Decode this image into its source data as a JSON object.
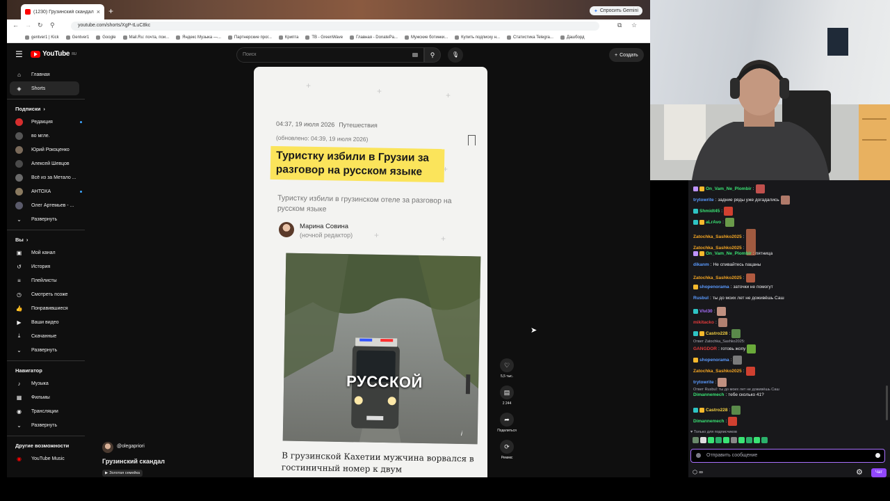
{
  "browser": {
    "tab_title": "(1230) Грузинский скандал",
    "new_tab": "+",
    "gemini_button": "Спросить Gemini",
    "url": "youtube.com/shorts/XgP-tLuC8kc",
    "bookmarks": [
      "gentver1 | Kick",
      "Gentver1",
      "Google",
      "Mail.Ru: почта, пои...",
      "Яндекс Музыка —...",
      "Партнерские прог...",
      "Крипта",
      "TB - GreenWave",
      "Главная - DonatePa...",
      "Мужские ботинки...",
      "Купить подписку н...",
      "Статистика Telegra...",
      "Дашборд"
    ]
  },
  "youtube": {
    "logo": "YouTube",
    "region": "RU",
    "search_placeholder": "Поиск",
    "create_label": "Создать",
    "sidebar": {
      "main": [
        {
          "label": "Главная",
          "icon": "home-icon"
        },
        {
          "label": "Shorts",
          "icon": "shorts-icon"
        }
      ],
      "subscriptions_title": "Подписки",
      "subscriptions": [
        {
          "label": "Редакция",
          "color": "#d62e2e",
          "live": true
        },
        {
          "label": "во мгле.",
          "color": "#555555",
          "live": false
        },
        {
          "label": "Юрий Рокоценко",
          "color": "#7a6a5a",
          "live": false
        },
        {
          "label": "Алексей Шевцов",
          "color": "#4a4a4a",
          "live": false
        },
        {
          "label": "Всё из за Метало ...",
          "color": "#6a6a6a",
          "live": true
        },
        {
          "label": "АНТОХА",
          "color": "#8a7a60",
          "live": true
        },
        {
          "label": "Олег Артемьев - ...",
          "color": "#5a5a6a",
          "live": true
        }
      ],
      "expand_label": "Развернуть",
      "you_title": "Вы",
      "you_items": [
        {
          "label": "Мой канал",
          "icon": "channel-icon"
        },
        {
          "label": "История",
          "icon": "history-icon"
        },
        {
          "label": "Плейлисты",
          "icon": "playlists-icon"
        },
        {
          "label": "Смотреть позже",
          "icon": "watch-later-icon"
        },
        {
          "label": "Понравившиеся",
          "icon": "like-icon"
        },
        {
          "label": "Ваши видео",
          "icon": "your-videos-icon"
        },
        {
          "label": "Скачанные",
          "icon": "download-icon"
        }
      ],
      "expand_label2": "Развернуть",
      "navigator_title": "Навигатор",
      "navigator_items": [
        {
          "label": "Музыка",
          "icon": "music-icon"
        },
        {
          "label": "Фильмы",
          "icon": "film-icon"
        },
        {
          "label": "Трансляции",
          "icon": "live-icon"
        }
      ],
      "expand_label3": "Развернуть",
      "more_title": "Другие возможности",
      "more_items": [
        {
          "label": "YouTube Music",
          "icon": "youtube-music-icon"
        }
      ]
    },
    "short": {
      "article": {
        "time": "04:37, 19 июля 2026",
        "category": "Путешествия",
        "updated": "(обновлено: 04:39, 19 июля 2026)",
        "headline": "Туристку избили в Грузии за разговор на русском языке",
        "lead": "Туристку избили в грузинском отеле за разговор на русском языке",
        "author": "Марина Совина",
        "author_role": "(ночной редактор)",
        "photo_caption": "РУССКОЙ",
        "photo_info": "i",
        "body": "В грузинской Кахетии мужчина ворвался в гостиничный номер к двум"
      },
      "channel": "@olegapriori",
      "title": "Грузинский скандал",
      "music": "Золотая семейка",
      "actions": [
        {
          "name": "like",
          "icon": "♡",
          "label": "5,5 тыс."
        },
        {
          "name": "comments",
          "icon": "▤",
          "label": "2 244"
        },
        {
          "name": "share",
          "icon": "➦",
          "label": "Поделиться"
        },
        {
          "name": "remix",
          "icon": "⟳",
          "label": "Ремикс"
        }
      ]
    }
  },
  "chat": {
    "messages": [
      {
        "user": "On_Vam_Ne_Plombir",
        "color": "#3ae374",
        "text": "",
        "badges": [
          "#bf94ff",
          "#f5b92d"
        ],
        "emote": "#c0504d"
      },
      {
        "user": "trytowrite",
        "color": "#5b9bff",
        "text": "задние ряды уже догадались",
        "badges": [],
        "emote": "#b07a6a"
      },
      {
        "user": "Shmidt45",
        "color": "#3ae374",
        "text": "",
        "badges": [
          "#2ec4c4"
        ],
        "emote": "#d04030"
      },
      {
        "user": "aLrAvo",
        "color": "#3ae374",
        "text": "",
        "badges": [
          "#2ec4c4",
          "#f5b92d"
        ],
        "emote": "#6a9a4a"
      },
      {
        "user": "Zatochka_Sashko2025",
        "color": "#f5a623",
        "text": "",
        "badges": [],
        "emote": "#a05a40",
        "tall": true
      },
      {
        "user": "Zatochka_Sashko2025",
        "color": "#f5a623",
        "text": "",
        "badges": [],
        "emote": "#a05a40",
        "tall": true
      },
      {
        "user": "On_Vam_Ne_Plombir",
        "color": "#3ae374",
        "text": "пятница",
        "badges": [
          "#bf94ff",
          "#f5b92d"
        ]
      },
      {
        "user": "dikanm",
        "color": "#5b9bff",
        "text": "Не спивайтесь пацаны",
        "badges": []
      },
      {
        "user": "Zatochka_Sashko2025",
        "color": "#f5a623",
        "text": "",
        "badges": [],
        "emote": "#b05a40"
      },
      {
        "user": "shopenorama",
        "color": "#5b9bff",
        "text": "заточки не помогут",
        "badges": [
          "#f5b92d"
        ]
      },
      {
        "user": "Rusbul",
        "color": "#5b9bff",
        "text": "ты до моих лет не доживёшь Саш",
        "badges": []
      },
      {
        "user": "Vivi30",
        "color": "#a970ff",
        "text": "",
        "badges": [
          "#2ec4c4"
        ],
        "emote": "#c09080"
      },
      {
        "user": "mikitacko",
        "color": "#e33b3b",
        "text": "",
        "badges": [],
        "emote": "#b08070"
      },
      {
        "user": "Castro228",
        "color": "#f5d142",
        "text": "",
        "badges": [
          "#2ec4c4",
          "#f5b92d"
        ],
        "emote": "#5a8a4a"
      },
      {
        "user": "GANGDOR",
        "color": "#e33b3b",
        "text": "готовь жопу",
        "badges": [],
        "emote": "#6aaa3a",
        "reply": "Ответ Zatochka_Sashko2025:"
      },
      {
        "user": "shopenorama",
        "color": "#5b9bff",
        "text": "",
        "badges": [
          "#f5b92d"
        ],
        "emote": "#7a7a7a"
      },
      {
        "user": "Zatochka_Sashko2025",
        "color": "#f5a623",
        "text": "",
        "badges": [],
        "emote": "#d04030"
      },
      {
        "user": "trytowrite",
        "color": "#5b9bff",
        "text": "",
        "badges": [],
        "emote": "#c09080"
      },
      {
        "user": "Dimannemech",
        "color": "#3ae374",
        "text": "тебе сколько 41?",
        "badges": [],
        "reply": "Ответ Rusbul: ты до моих лет не доживёшь Саш"
      },
      {
        "user": "Castro228",
        "color": "#f5d142",
        "text": "",
        "badges": [
          "#2ec4c4",
          "#f5b92d"
        ],
        "emote": "#5a8a4a"
      },
      {
        "user": "Dimannemech",
        "color": "#3ae374",
        "text": "",
        "badges": [],
        "emote": "#d04030"
      }
    ],
    "sub_only_label": "Только для подписчиков",
    "input_placeholder": "Отправить сообщение",
    "chat_button": "Чат",
    "points_label": "∞"
  }
}
